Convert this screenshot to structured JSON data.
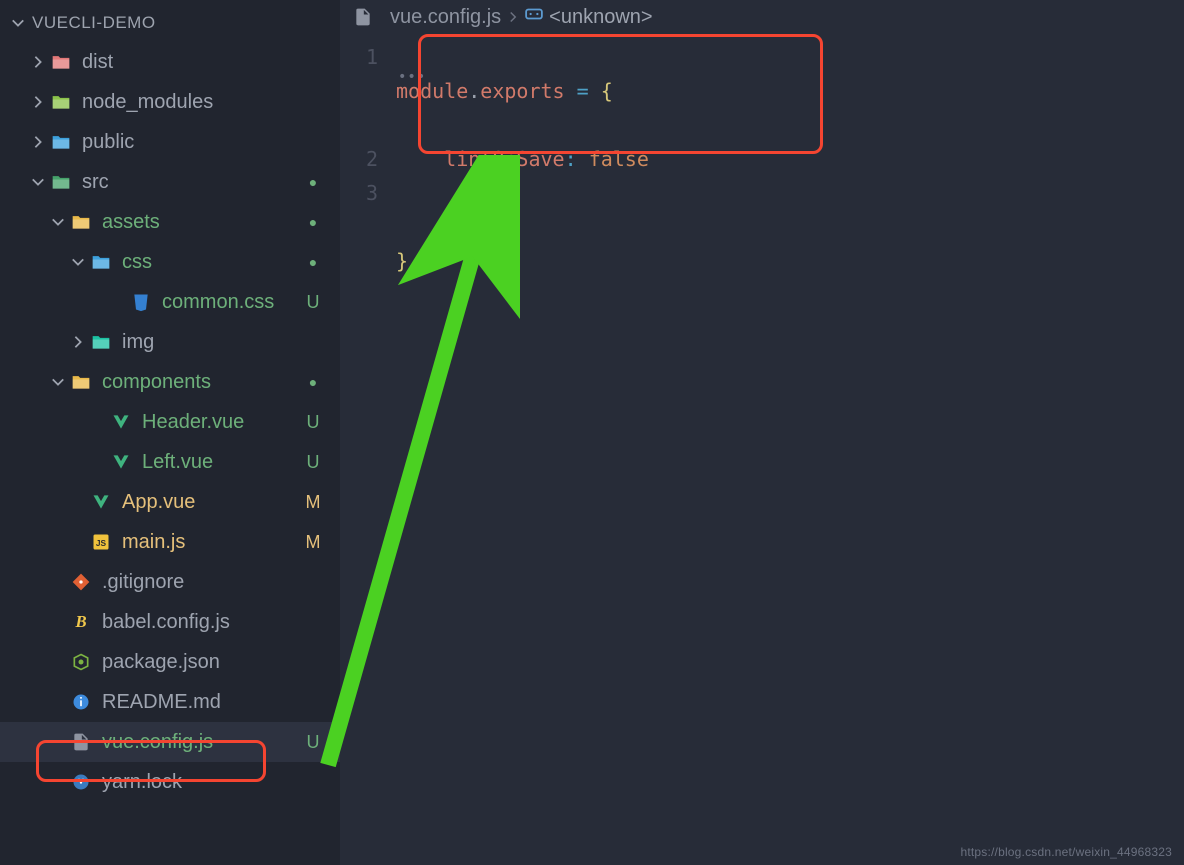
{
  "project_name": "VUECLI-DEMO",
  "sidebar": {
    "items": [
      {
        "label": "dist",
        "indent": 28,
        "chev": "right",
        "icon": "folder-dist",
        "badge": "",
        "cls": ""
      },
      {
        "label": "node_modules",
        "indent": 28,
        "chev": "right",
        "icon": "folder-modules",
        "badge": "",
        "cls": ""
      },
      {
        "label": "public",
        "indent": 28,
        "chev": "right",
        "icon": "folder-public",
        "badge": "",
        "cls": ""
      },
      {
        "label": "src",
        "indent": 28,
        "chev": "down",
        "icon": "folder-src",
        "badge": "dot",
        "cls": ""
      },
      {
        "label": "assets",
        "indent": 48,
        "chev": "down",
        "icon": "folder-assets",
        "badge": "dot",
        "cls": "green"
      },
      {
        "label": "css",
        "indent": 68,
        "chev": "down",
        "icon": "folder-css",
        "badge": "dot",
        "cls": "green"
      },
      {
        "label": "common.css",
        "indent": 108,
        "chev": "",
        "icon": "file-css",
        "badge": "U",
        "cls": "green"
      },
      {
        "label": "img",
        "indent": 68,
        "chev": "right",
        "icon": "folder-img",
        "badge": "",
        "cls": ""
      },
      {
        "label": "components",
        "indent": 48,
        "chev": "down",
        "icon": "folder-components",
        "badge": "dot",
        "cls": "green"
      },
      {
        "label": "Header.vue",
        "indent": 88,
        "chev": "",
        "icon": "file-vue",
        "badge": "U",
        "cls": "green"
      },
      {
        "label": "Left.vue",
        "indent": 88,
        "chev": "",
        "icon": "file-vue",
        "badge": "U",
        "cls": "green"
      },
      {
        "label": "App.vue",
        "indent": 68,
        "chev": "",
        "icon": "file-vue",
        "badge": "M",
        "cls": "yellow"
      },
      {
        "label": "main.js",
        "indent": 68,
        "chev": "",
        "icon": "file-js",
        "badge": "M",
        "cls": "yellow"
      },
      {
        "label": ".gitignore",
        "indent": 48,
        "chev": "",
        "icon": "file-git",
        "badge": "",
        "cls": ""
      },
      {
        "label": "babel.config.js",
        "indent": 48,
        "chev": "",
        "icon": "file-babel",
        "badge": "",
        "cls": ""
      },
      {
        "label": "package.json",
        "indent": 48,
        "chev": "",
        "icon": "file-npm",
        "badge": "",
        "cls": ""
      },
      {
        "label": "README.md",
        "indent": 48,
        "chev": "",
        "icon": "file-info",
        "badge": "",
        "cls": ""
      },
      {
        "label": "vue.config.js",
        "indent": 48,
        "chev": "",
        "icon": "file-config",
        "badge": "U",
        "cls": "green",
        "selected": true
      },
      {
        "label": "yarn.lock",
        "indent": 48,
        "chev": "",
        "icon": "file-yarn",
        "badge": "",
        "cls": ""
      }
    ]
  },
  "breadcrumb": {
    "file": "vue.config.js",
    "symbol": "<unknown>"
  },
  "code": {
    "lines": [
      "1",
      "2",
      "3"
    ],
    "tok": {
      "module": "module",
      "exports": "exports",
      "eq": " = ",
      "lbrace": "{",
      "prop": "lintOnSave",
      "colon": ":",
      "space": " ",
      "val": "false",
      "rbrace": "}"
    }
  },
  "watermark": "https://blog.csdn.net/weixin_44968323"
}
